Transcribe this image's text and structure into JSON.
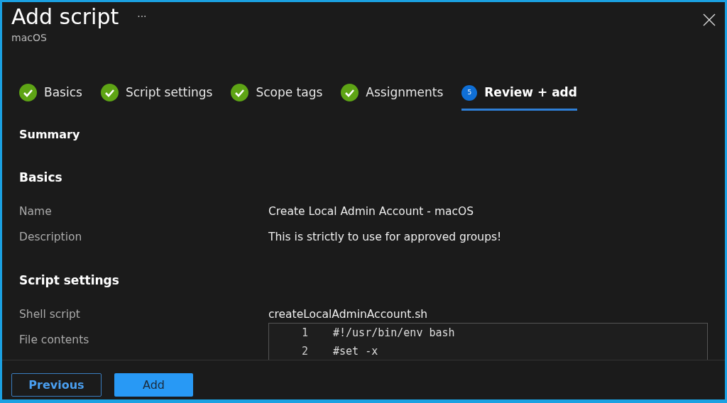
{
  "header": {
    "title": "Add script",
    "more": "···",
    "subtitle": "macOS"
  },
  "steps": [
    {
      "label": "Basics",
      "kind": "done",
      "selected": false
    },
    {
      "label": "Script settings",
      "kind": "done",
      "selected": false
    },
    {
      "label": "Scope tags",
      "kind": "done",
      "selected": false
    },
    {
      "label": "Assignments",
      "kind": "done",
      "selected": false
    },
    {
      "label": "Review + add",
      "kind": "current",
      "number": "5",
      "selected": true
    }
  ],
  "summary_title": "Summary",
  "sections": [
    {
      "title": "Basics",
      "rows": [
        {
          "label": "Name",
          "value": "Create Local Admin Account - macOS"
        },
        {
          "label": "Description",
          "value": "This is strictly to use for approved groups!"
        }
      ]
    },
    {
      "title": "Script settings",
      "rows": [
        {
          "label": "Shell script",
          "value": "createLocalAdminAccount.sh"
        },
        {
          "label": "File contents",
          "kind": "code",
          "lines": [
            {
              "number": "1",
              "text": "#!/usr/bin/env bash"
            },
            {
              "number": "2",
              "text": "#set -x"
            }
          ]
        }
      ]
    }
  ],
  "footer": {
    "buttons": [
      {
        "label": "Previous",
        "kind": "secondary"
      },
      {
        "label": "Add",
        "kind": "primary"
      }
    ]
  }
}
